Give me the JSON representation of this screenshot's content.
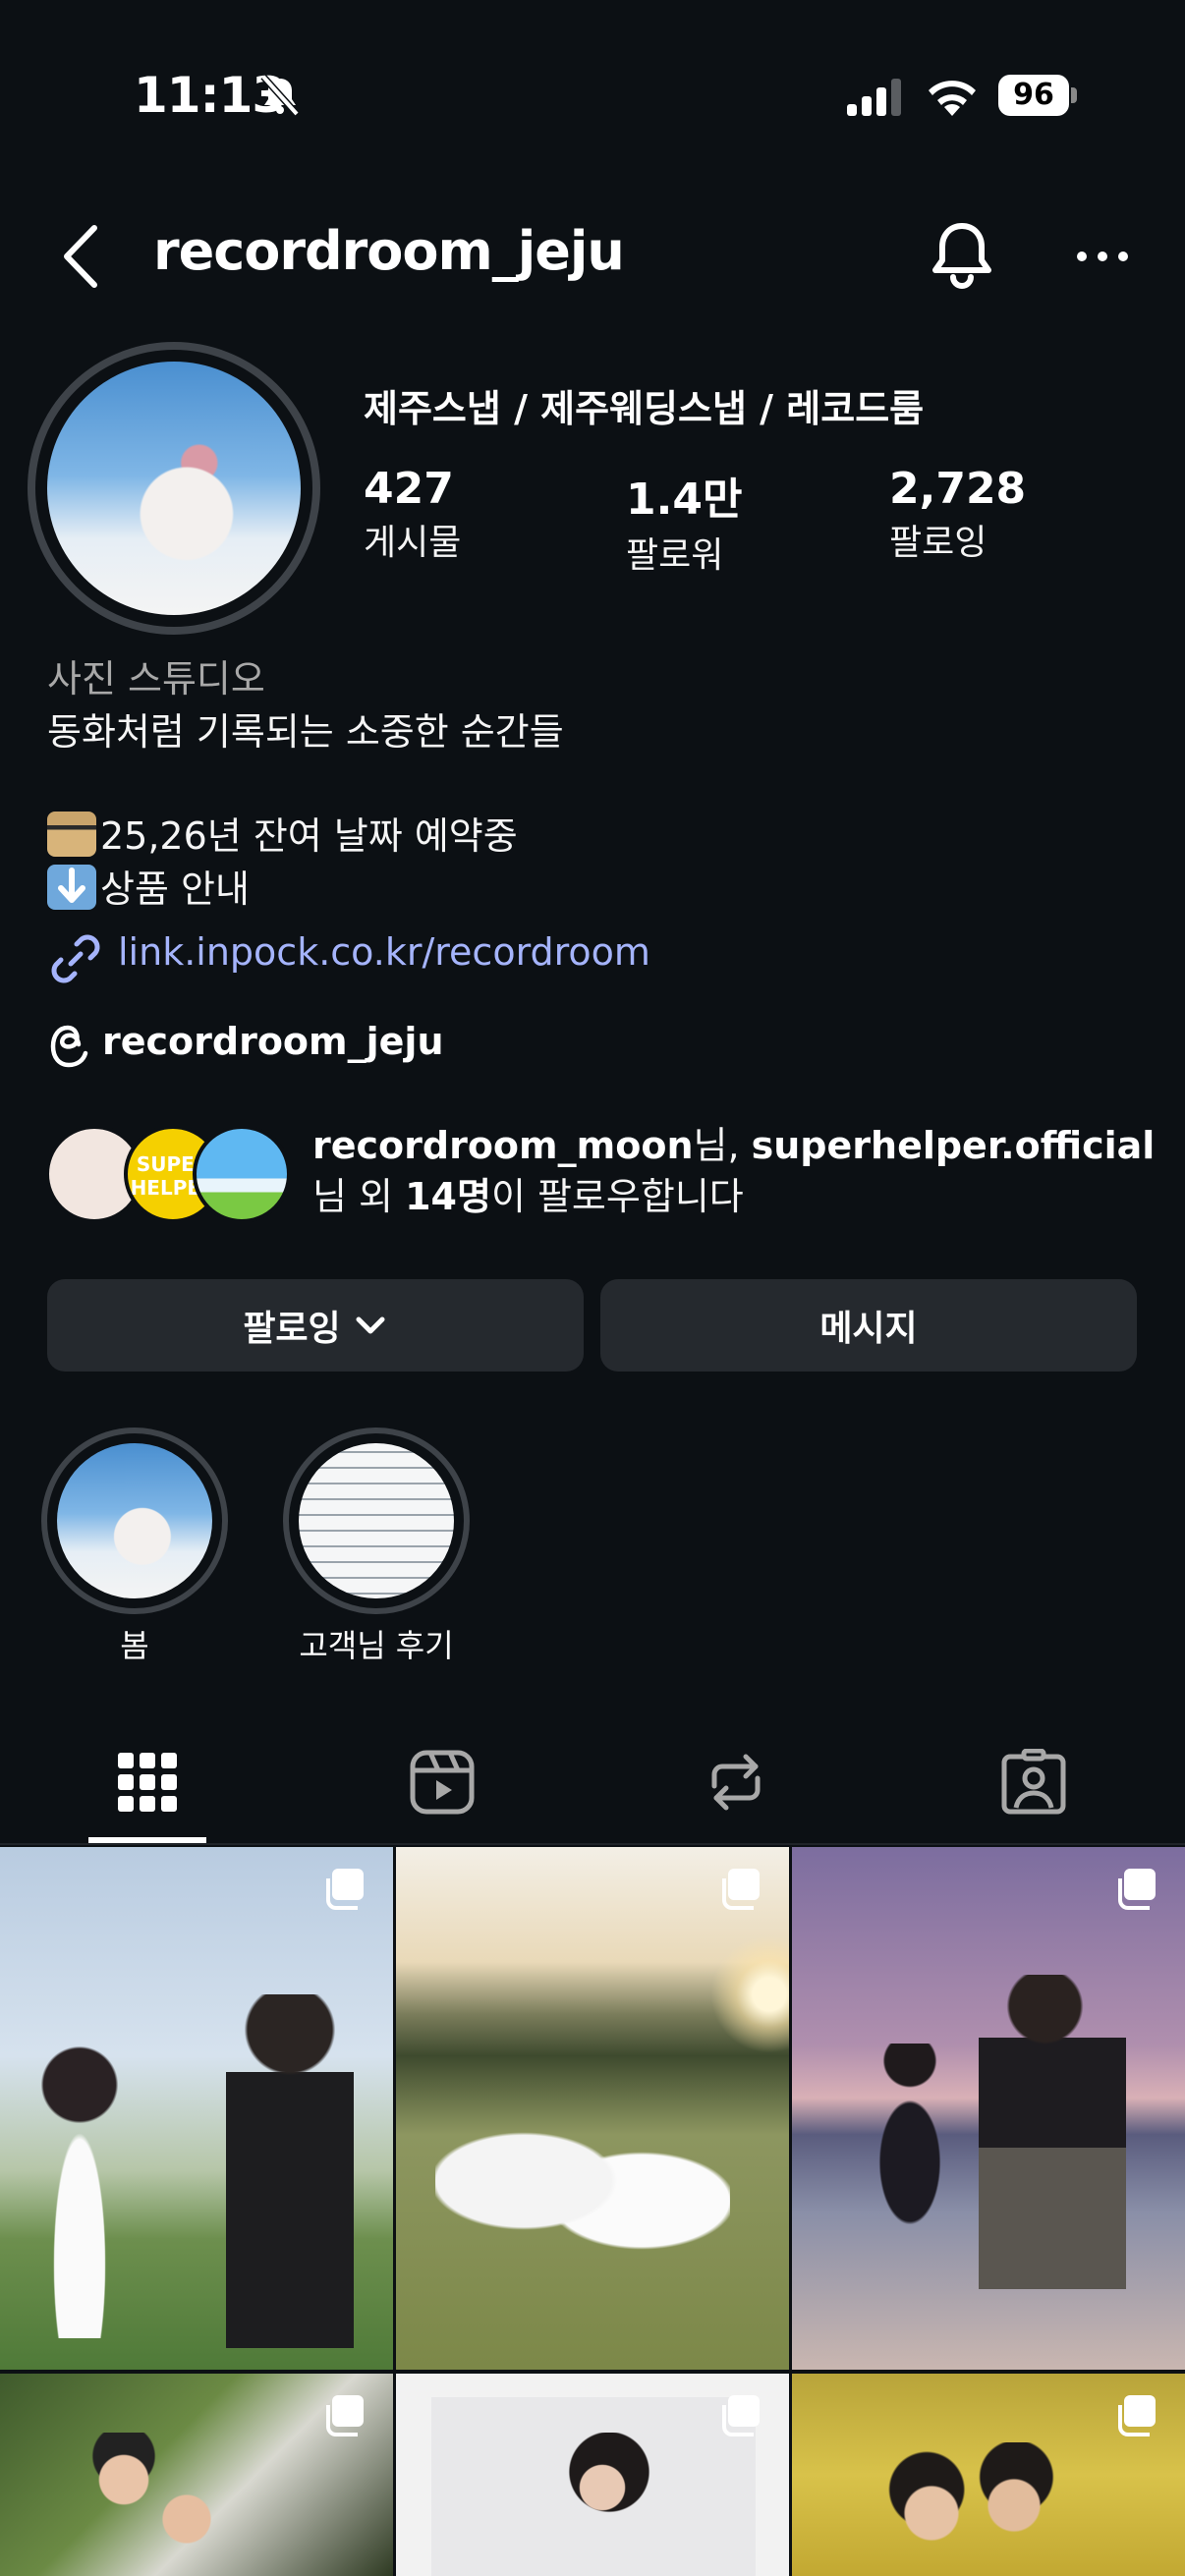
{
  "status_bar": {
    "time": "11:13",
    "battery": "96"
  },
  "header": {
    "username": "recordroom_jeju"
  },
  "profile": {
    "display_name": "제주스냅 / 제주웨딩스냅 / 레코드룸",
    "stats": [
      {
        "value": "427",
        "label": "게시물"
      },
      {
        "value": "1.4만",
        "label": "팔로워"
      },
      {
        "value": "2,728",
        "label": "팔로잉"
      }
    ],
    "category": "사진 스튜디오",
    "bio_line1": "동화처럼 기록되는 소중한 순간들",
    "bio_line2": "25,26년 잔여 날짜 예약중",
    "bio_line3": "상품 안내",
    "link": "link.inpock.co.kr/recordroom",
    "threads": "recordroom_jeju"
  },
  "mutuals": {
    "text_a": "recordroom_moon",
    "text_b": "님, ",
    "text_c": "superhelper.official",
    "text_d": "님 외 ",
    "text_e": "14명",
    "text_f": "이 팔로우합니다",
    "avatar2_text": "SUPER HELPER"
  },
  "buttons": {
    "following": "팔로잉",
    "message": "메시지"
  },
  "highlights": [
    {
      "label": "봄"
    },
    {
      "label": "고객님 후기"
    }
  ],
  "tabs": [
    "posts-grid",
    "reels",
    "reposts",
    "tagged"
  ]
}
